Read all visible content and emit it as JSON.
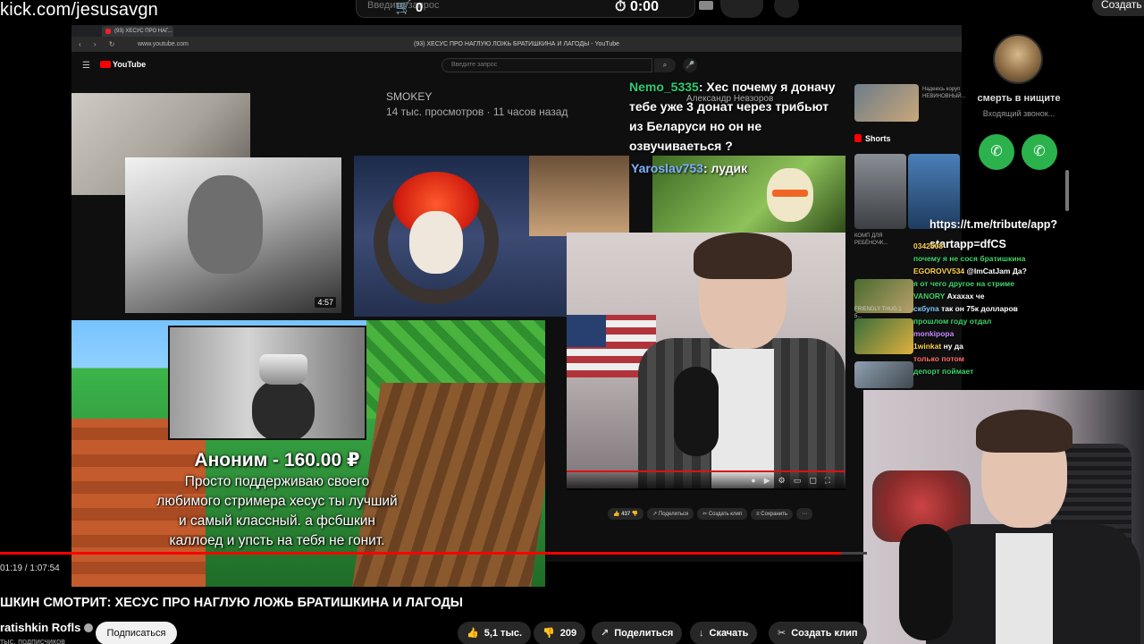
{
  "overlay": {
    "watermark": "kick.com/jesusavgn",
    "telegram_link_line1": "https://t.me/tribute/app?",
    "telegram_link_line2": "startapp=dfCS"
  },
  "outer_bar": {
    "search_placeholder": "Введите запрос",
    "cart_count": "0",
    "timer": "0:00",
    "create_label": "Создать"
  },
  "browser": {
    "tab_title": "(93) ХЕСУС ПРО НАГ...",
    "url": "www.youtube.com",
    "window_title": "(93) ХЕСУС ПРО НАГЛУЮ ЛОЖЬ БРАТИШКИНА И ЛАГОДЫ - YouTube",
    "yt_search_placeholder": "Введите запрос",
    "yt_logo": "YouTube"
  },
  "embedded": {
    "list_channel": "SMOKEY",
    "list_meta": "14 тыс. просмотров · 11 часов назад",
    "thumb_duration": "4:57",
    "action_like_count": "437"
  },
  "donation": {
    "header": "Аноним - 160.00 ₽",
    "lines": [
      "Просто поддерживаю своего",
      "любимого стримера хесус ты лучший",
      "и самый классный. а фсбшкин",
      "каллоед и упсть на тебя не гонит."
    ]
  },
  "chat_mid": {
    "user1": "Nemo_5335",
    "sub1": "Александр Невзоров",
    "msg1": ": Хес почему я доначу тебе уже 3 донат через трибьют из Беларуси но он не озвучиваеться ?",
    "user2": "Yaroslav753",
    "msg2": ": лудик"
  },
  "chat_col": [
    {
      "user": "",
      "color": "y",
      "text": "0342508"
    },
    {
      "user": "",
      "color": "g",
      "text": "почему я не сося братишкина"
    },
    {
      "user": "EGOROVV534",
      "color": "y",
      "text": "@ImCatJam Да?"
    },
    {
      "user": "",
      "color": "g",
      "text": "я от чего другое на стриме"
    },
    {
      "user": "VANORY",
      "color": "g",
      "text": "Ахахах че"
    },
    {
      "user": "скбупа",
      "color": "c",
      "text": "так он 75к долларов"
    },
    {
      "user": "",
      "color": "g",
      "text": "прошлом году отдал"
    },
    {
      "user": "monkipopa",
      "color": "p",
      "text": ""
    },
    {
      "user": "1winkat",
      "color": "y",
      "text": "ну да"
    },
    {
      "user": "",
      "color": "r",
      "text": "только потом"
    },
    {
      "user": "",
      "color": "g",
      "text": "депорт поймает"
    }
  ],
  "call": {
    "name": "смерть в нищите",
    "status": "Входящий звонок..."
  },
  "sidebar": {
    "shorts_label": "Shorts",
    "item1": "Надеюсь коруп НЕВИНОВНЫЙ...",
    "item2": "КОМП ДЛЯ РЕБЁНОЧК...",
    "item3": "FRIENDLY THUG 1 5..."
  },
  "player": {
    "timecode": "01:19 / 1:07:54",
    "progress_fraction": 0.97,
    "title": "ШКИН СМОТРИТ: ХЕСУС ПРО НАГЛУЮ ЛОЖЬ БРАТИШКИНА И ЛАГОДЫ",
    "channel": "ratishkin Rofls",
    "subscribers": "тыс. подписчиков",
    "subscribe_label": "Подписаться",
    "likes": "5,1 тыс.",
    "dislikes": "209",
    "share_label": "Поделиться",
    "download_label": "Скачать",
    "clip_label": "Создать клип"
  },
  "colors": {
    "accent_red": "#ff0000",
    "call_green": "#2bb24c",
    "chat_green": "#3fd46a",
    "chat_blue": "#7fb3ff"
  }
}
